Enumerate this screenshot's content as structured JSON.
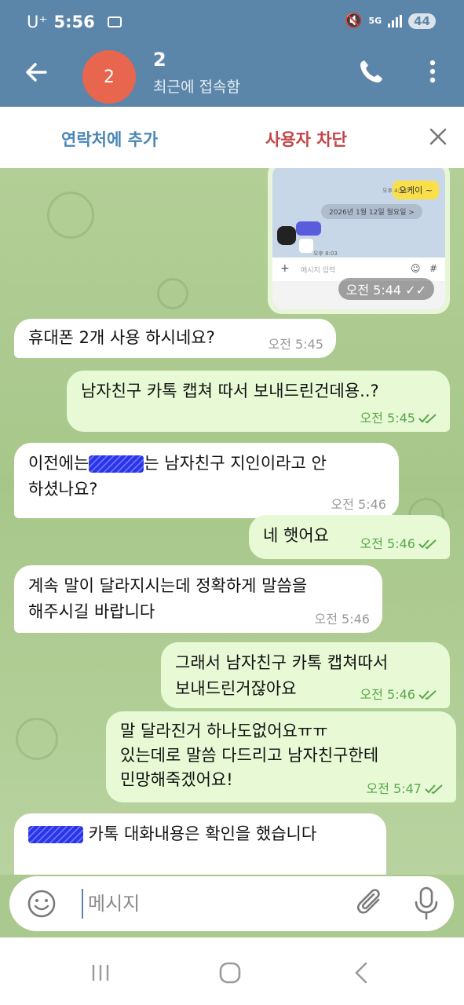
{
  "status_bar": {
    "carrier": "U⁺",
    "time": "5:56",
    "network": "5G",
    "battery": "44"
  },
  "header": {
    "avatar_text": "2",
    "name": "2",
    "status": "최근에 접속함"
  },
  "action_bar": {
    "add_contact": "연락처에 추가",
    "block_user": "사용자 차단"
  },
  "photo_message": {
    "preview_reply": "오케이 ~",
    "preview_time_1": "오후 4:16",
    "preview_date": "2026년 1월 12일 월요일 >",
    "preview_time_2": "오후 8:03",
    "preview_input_placeholder": "메시지 입력",
    "preview_input_plus": "+",
    "preview_input_hash": "#",
    "time": "오전 5:44"
  },
  "messages": [
    {
      "dir": "in",
      "text": "휴대폰 2개 사용 하시네요?",
      "time": "오전 5:45"
    },
    {
      "dir": "out",
      "text": "남자친구 카톡 캡쳐 따서 보내드린건데용..?",
      "time": "오전 5:45"
    },
    {
      "dir": "in",
      "text_before": "이전에는",
      "text_after": "는 남자친구 지인이라고 안",
      "text_line2": "하셨나요?",
      "time": "오전 5:46"
    },
    {
      "dir": "out",
      "text": "네 햇어요",
      "time": "오전 5:46"
    },
    {
      "dir": "in",
      "text_line1": "계속 말이 달라지시는데 정확하게 말씀을",
      "text_line2": "해주시길 바랍니다",
      "time": "오전 5:46"
    },
    {
      "dir": "out",
      "text_line1": "그래서 남자친구 카톡 캡쳐따서",
      "text_line2": "보내드린거잖아요",
      "time": "오전 5:46"
    },
    {
      "dir": "out",
      "text_line1": "말 달라진거 하나도없어요ㅠㅠ",
      "text_line2": "있는데로 말씀 다드리고 남자친구한테",
      "text_line3": "민망해죽겠어요!",
      "time": "오전 5:47"
    },
    {
      "dir": "in",
      "text_after": " 카톡 대화내용은 확인을 했습니다"
    }
  ],
  "composer": {
    "placeholder": "메시지"
  },
  "colors": {
    "header": "#5c86a9",
    "outgoing_bubble": "#e7fad5",
    "incoming_bubble": "#ffffff",
    "tick": "#5aa64c",
    "block_red": "#c44548",
    "avatar": "#e8654e"
  }
}
